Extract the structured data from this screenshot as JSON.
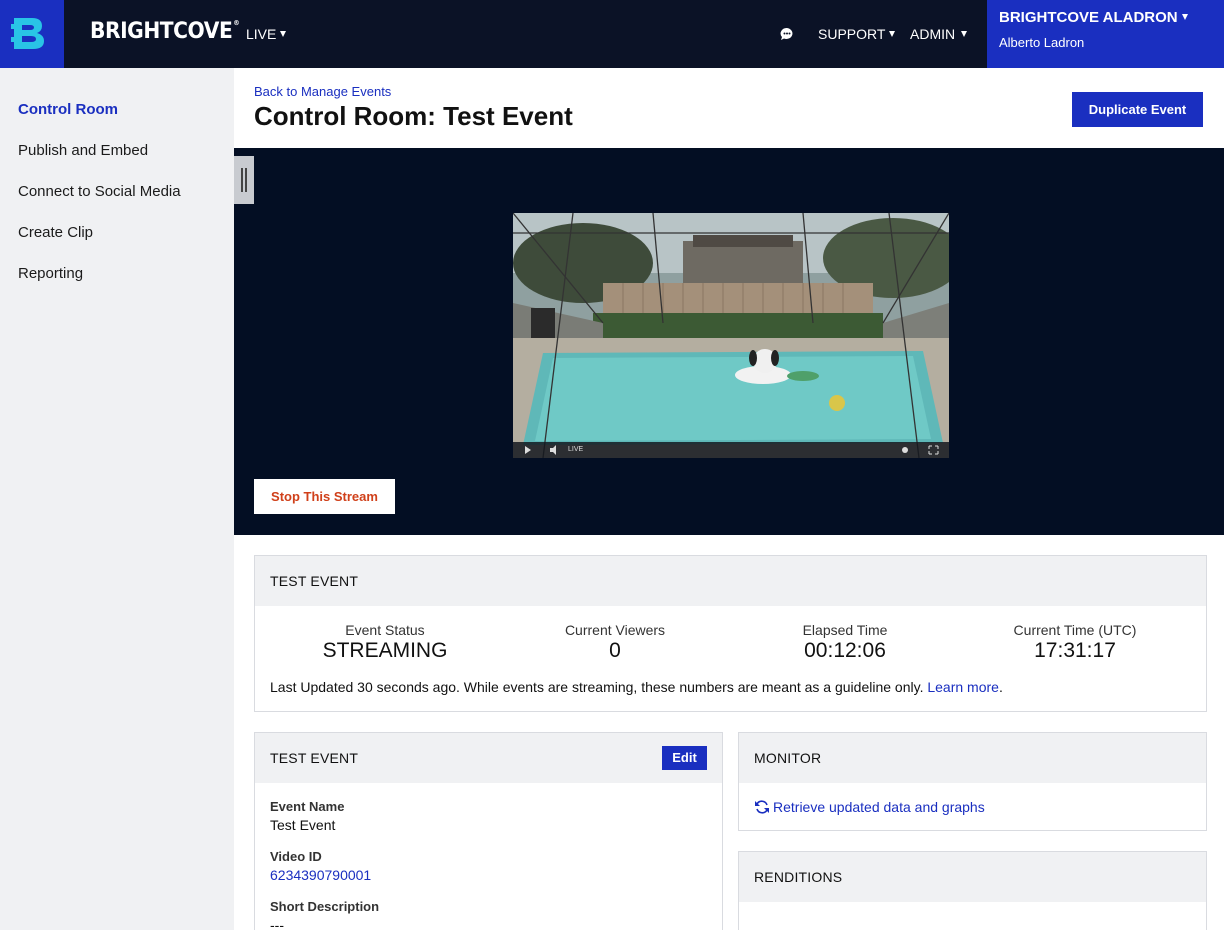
{
  "topbar": {
    "brand": "BRIGHTCOVE",
    "nav": [
      {
        "label": "LIVE"
      },
      {
        "label": "SUPPORT"
      },
      {
        "label": "ADMIN"
      }
    ],
    "account": {
      "name": "BRIGHTCOVE ALADRON",
      "user": "Alberto Ladron"
    },
    "accent": "#1a2fc0",
    "bg": "#0b1226"
  },
  "sidebar": {
    "items": [
      {
        "label": "Control Room",
        "active": true
      },
      {
        "label": "Publish and Embed"
      },
      {
        "label": "Connect to Social Media"
      },
      {
        "label": "Create Clip"
      },
      {
        "label": "Reporting"
      }
    ]
  },
  "header": {
    "back_link": "Back to Manage Events",
    "title": "Control Room: Test Event",
    "duplicate_label": "Duplicate Event"
  },
  "player": {
    "live_label": "LIVE",
    "stop_label": "Stop This Stream"
  },
  "stats_panel": {
    "title": "TEST EVENT",
    "stats": [
      {
        "label": "Event Status",
        "value": "STREAMING"
      },
      {
        "label": "Current Viewers",
        "value": "0"
      },
      {
        "label": "Elapsed Time",
        "value": "00:12:06"
      },
      {
        "label": "Current Time (UTC)",
        "value": "17:31:17"
      }
    ],
    "note": "Last Updated 30 seconds ago. While events are streaming, these numbers are meant as a guideline only.",
    "learn_more": "Learn more",
    "note_end": "."
  },
  "details_panel": {
    "title": "TEST EVENT",
    "edit_label": "Edit",
    "fields": [
      {
        "label": "Event Name",
        "value": "Test Event"
      },
      {
        "label": "Video ID",
        "value": "6234390790001"
      },
      {
        "label": "Short Description",
        "value": "---"
      }
    ]
  },
  "monitor_panel": {
    "title": "MONITOR",
    "link": "Retrieve updated data and graphs"
  },
  "renditions_panel": {
    "title": "RENDITIONS"
  }
}
